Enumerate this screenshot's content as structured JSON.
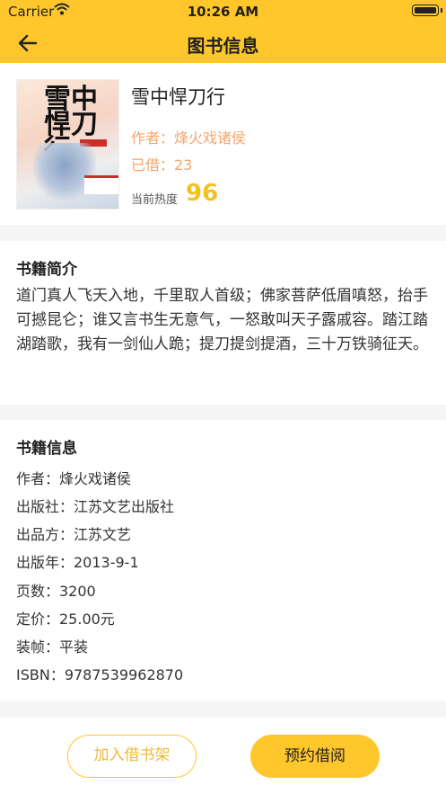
{
  "status_bar": {
    "carrier": "Carrier",
    "time": "10:26 AM"
  },
  "nav": {
    "title": "图书信息"
  },
  "book": {
    "title": "雪中悍刀行",
    "author_line": "作者：烽火戏诸侯",
    "borrowed_line": "已借：23",
    "heat_label": "当前热度",
    "heat_value": "96",
    "cover_text": "雪中悍刀行"
  },
  "intro": {
    "heading": "书籍简介",
    "text": "道门真人飞天入地，千里取人首级；佛家菩萨低眉嗔怒，抬手可撼昆仑；谁又言书生无意气，一怒敢叫天子露戚容。踏江踏湖踏歌，我有一剑仙人跪；提刀提剑提酒，三十万铁骑征天。"
  },
  "details": {
    "heading": "书籍信息",
    "lines": [
      "作者：烽火戏诸侯",
      "出版社：江苏文艺出版社",
      "出品方：江苏文艺",
      "出版年：2013-9-1",
      "页数：3200",
      "定价：25.00元",
      "装帧：平装",
      "ISBN：9787539962870"
    ]
  },
  "actions": {
    "add_to_shelf": "加入借书架",
    "reserve": "预约借阅"
  },
  "colors": {
    "accent": "#ffc72c",
    "author_text": "#f4a56a",
    "heat": "#f4c21f"
  }
}
